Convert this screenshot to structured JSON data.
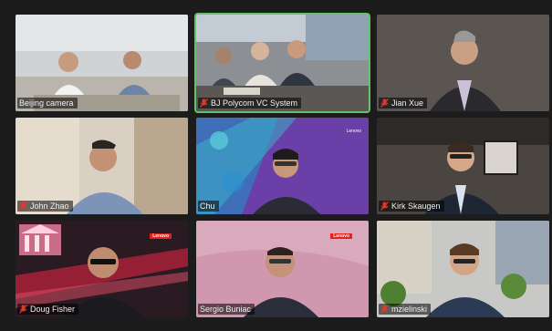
{
  "participants": [
    {
      "name": "Beijing camera",
      "muted": false
    },
    {
      "name": "BJ Polycom VC System",
      "muted": true
    },
    {
      "name": "Jian Xue",
      "muted": true
    },
    {
      "name": "John Zhao",
      "muted": true
    },
    {
      "name": "Chu",
      "muted": false
    },
    {
      "name": "Kirk Skaugen",
      "muted": true
    },
    {
      "name": "Doug Fisher",
      "muted": true
    },
    {
      "name": "Sergio Buniac",
      "muted": false
    },
    {
      "name": "mzielinski",
      "muted": true
    }
  ],
  "active_speaker_index": 1,
  "brand": "Lenovo",
  "colors": {
    "background": "#1c1c1c",
    "active_border": "#66c26a",
    "mute_icon": "#e0392b"
  }
}
